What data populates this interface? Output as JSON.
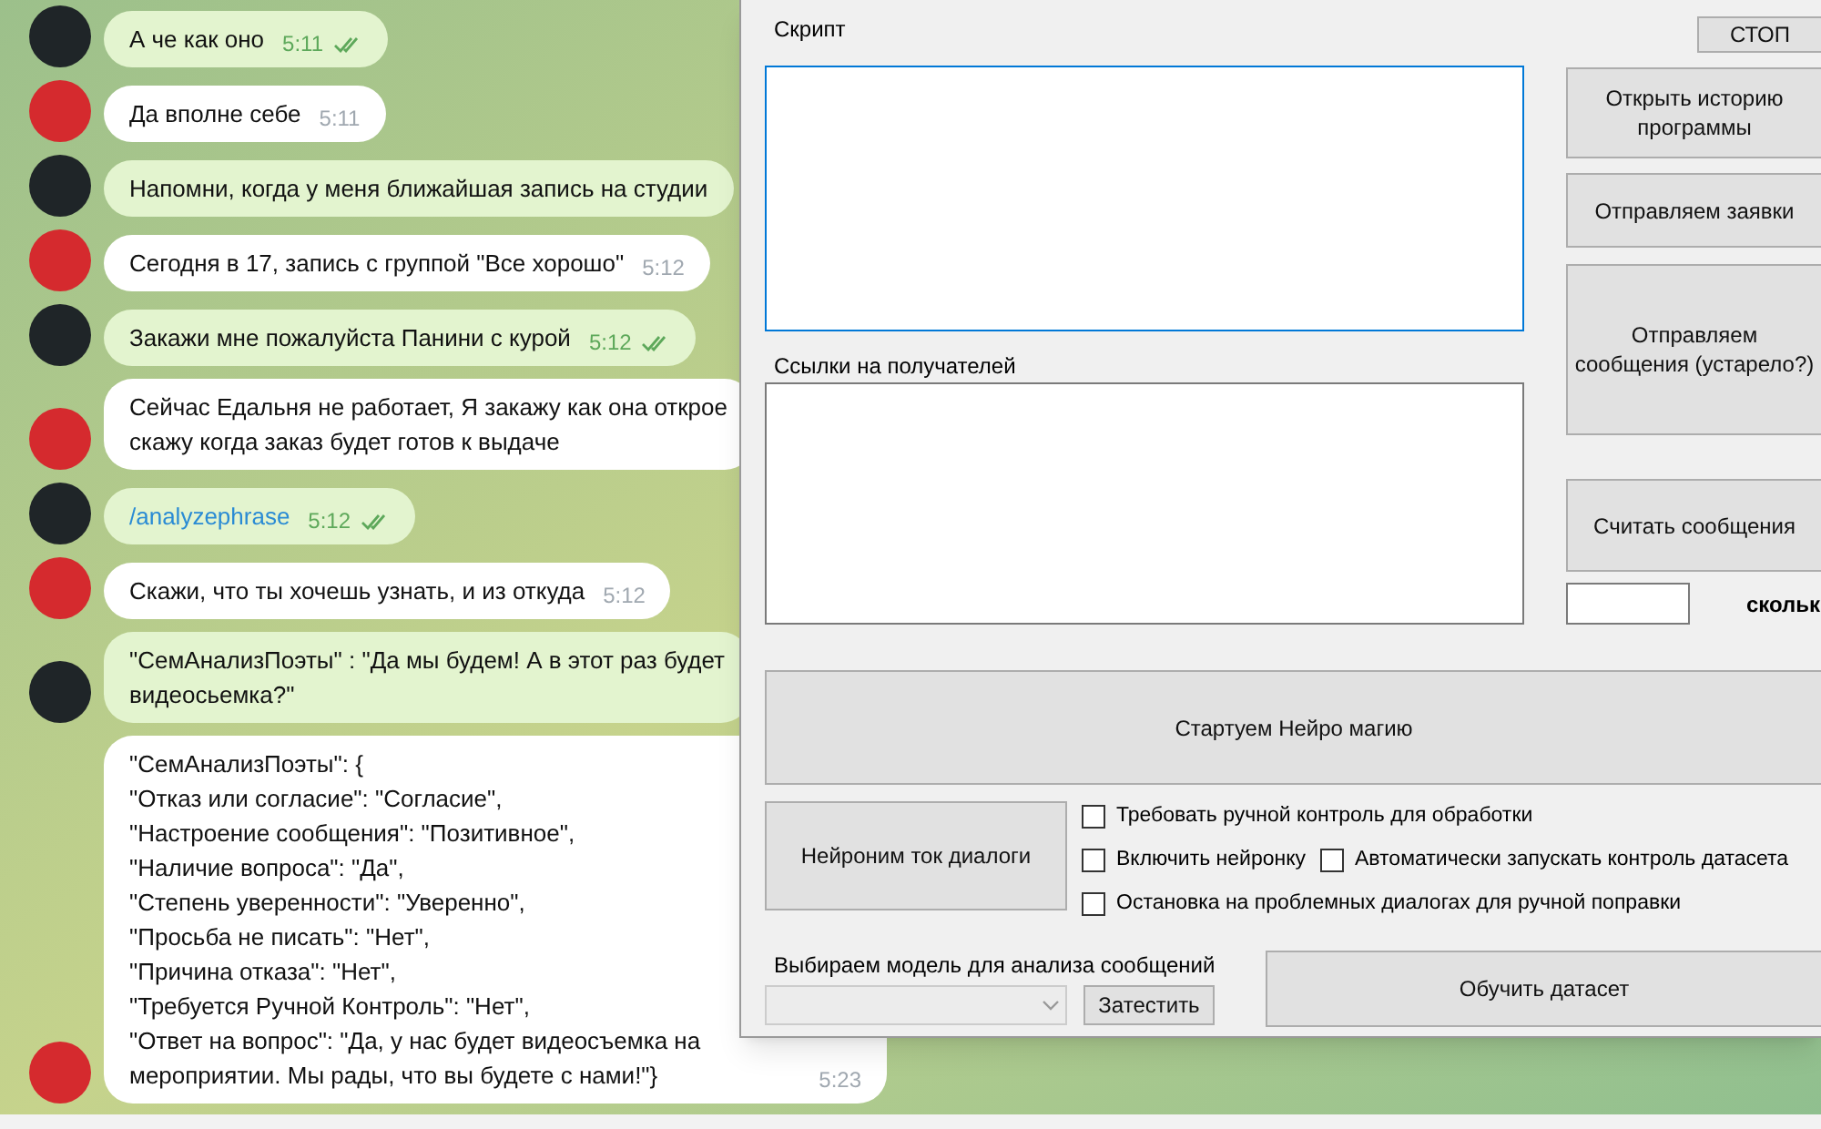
{
  "chat": {
    "messages": [
      {
        "kind": "outgoing",
        "text": "А че как оно",
        "time": "5:11",
        "read": true
      },
      {
        "kind": "incoming",
        "text": "Да вполне себе",
        "time": "5:11"
      },
      {
        "kind": "outgoing",
        "text": "Напомни, когда у меня ближайшая запись на студии"
      },
      {
        "kind": "incoming",
        "text": "Сегодня в 17, запись с группой \"Все хорошо\"",
        "time": "5:12"
      },
      {
        "kind": "outgoing",
        "text": "Закажи мне пожалуйста Панини с курой",
        "time": "5:12",
        "read": true
      },
      {
        "kind": "incoming",
        "text": "Сейчас Едальня не работает, Я закажу как она открое\nскажу когда заказ будет готов к выдаче"
      },
      {
        "kind": "outgoing",
        "text": "/analyzephrase",
        "command": true,
        "time": "5:12",
        "read": true
      },
      {
        "kind": "incoming",
        "text": "Скажи, что ты хочешь узнать, и из откуда",
        "time": "5:12"
      },
      {
        "kind": "outgoing",
        "text": "\"СемАнализПоэты\" : \"Да мы будем! А в этот раз будет\nвидеосьемка?\""
      },
      {
        "kind": "incoming",
        "text": "\"СемАнализПоэты\": {\n\"Отказ или согласие\": \"Согласие\",\n\"Настроение сообщения\": \"Позитивное\",\n\"Наличие вопроса\": \"Да\",\n\"Степень уверенности\": \"Уверенно\",\n\"Просьба не писать\": \"Нет\",\n\"Причина отказа\": \"Нет\",\n\"Требуется Ручной Контроль\": \"Нет\",\n\"Ответ на вопрос\": \"Да, у нас будет видеосъемка на\nмероприятии. Мы рады, что вы будете с нами!\"}",
        "time": "5:23"
      }
    ]
  },
  "form": {
    "script": {
      "label": "Скрипт",
      "focused": true
    },
    "recipients": {
      "label": "Ссылки на получателей",
      "focused": false
    },
    "stop_button": "СТОП",
    "side_buttons": [
      "Открыть историю\nпрограммы",
      "Отправляем заявки",
      "Отправляем\nсообщения (устарело?)",
      "Считать сообщения"
    ],
    "count_label": "скольк",
    "start_button": "Стартуем Нейро магию",
    "dialogs_button": "Нейроним ток диалоги",
    "option_rows": [
      {
        "options": [
          {
            "label": "Требовать ручной контроль для обработки",
            "checked": false
          }
        ]
      },
      {
        "options": [
          {
            "label": "Включить нейронку",
            "checked": false
          },
          {
            "label": "Автоматически запускать контроль датасета",
            "checked": false
          }
        ]
      },
      {
        "options": [
          {
            "label": "Остановка на проблемных диалогах для ручной поправки",
            "checked": false
          }
        ]
      }
    ],
    "model_label": "Выбираем модель для анализа сообщений",
    "model_select": {
      "disabled": true
    },
    "test_button": "Затестить",
    "train_button": "Обучить датасет"
  }
}
